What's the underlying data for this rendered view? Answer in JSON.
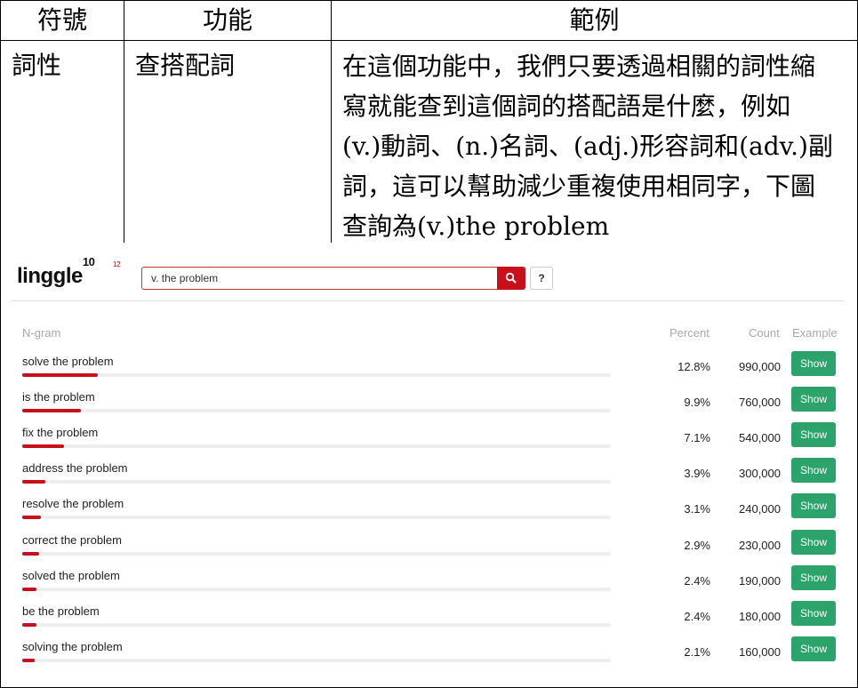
{
  "table": {
    "headers": [
      "符號",
      "功能",
      "範例"
    ],
    "row": {
      "symbol": "詞性",
      "function": "查搭配詞",
      "example_lines": [
        "在這個功能中，我們只要透過相關的詞性縮",
        "寫就能查到這個詞的搭配語是什麼，例如",
        "(v.)動詞、(n.)名詞、(adj.)形容詞和(adv.)副",
        "詞，這可以幫助減少重複使用相同字，下圖",
        "查詢為(v.)the problem"
      ]
    }
  },
  "linggle": {
    "logo": "linggle",
    "logo_sup": "10",
    "logo_tiny": "12",
    "query": "v. the problem",
    "help_label": "?",
    "columns": {
      "ngram": "N-gram",
      "percent": "Percent",
      "count": "Count",
      "example": "Example"
    },
    "show_label": "Show",
    "accent_red": "#c8101b",
    "show_green": "#2ca36a",
    "rows": [
      {
        "ngram": "solve the problem",
        "percent": "12.8%",
        "count": "990,000",
        "fraction": 0.128
      },
      {
        "ngram": "is the problem",
        "percent": "9.9%",
        "count": "760,000",
        "fraction": 0.099
      },
      {
        "ngram": "fix the problem",
        "percent": "7.1%",
        "count": "540,000",
        "fraction": 0.071
      },
      {
        "ngram": "address the problem",
        "percent": "3.9%",
        "count": "300,000",
        "fraction": 0.039
      },
      {
        "ngram": "resolve the problem",
        "percent": "3.1%",
        "count": "240,000",
        "fraction": 0.031
      },
      {
        "ngram": "correct the problem",
        "percent": "2.9%",
        "count": "230,000",
        "fraction": 0.029
      },
      {
        "ngram": "solved the problem",
        "percent": "2.4%",
        "count": "190,000",
        "fraction": 0.024
      },
      {
        "ngram": "be the problem",
        "percent": "2.4%",
        "count": "180,000",
        "fraction": 0.024
      },
      {
        "ngram": "solving the problem",
        "percent": "2.1%",
        "count": "160,000",
        "fraction": 0.021
      }
    ]
  }
}
